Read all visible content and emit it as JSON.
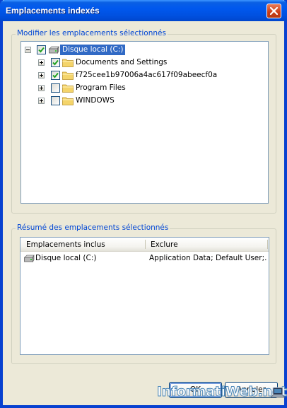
{
  "window": {
    "title": "Emplacements indexés"
  },
  "modify_group": {
    "legend": "Modifier les emplacements sélectionnés",
    "tree": [
      {
        "label": "Disque local (C:)",
        "level": 0,
        "expanded": true,
        "checked": true,
        "icon": "drive-icon",
        "selected": true
      },
      {
        "label": "Documents and Settings",
        "level": 1,
        "expanded": false,
        "checked": true,
        "icon": "folder-icon",
        "selected": false
      },
      {
        "label": "f725cee1b97006a4ac617f09abeecf0a",
        "level": 1,
        "expanded": false,
        "checked": true,
        "icon": "folder-icon",
        "selected": false
      },
      {
        "label": "Program Files",
        "level": 1,
        "expanded": false,
        "checked": false,
        "icon": "folder-icon",
        "selected": false
      },
      {
        "label": "WINDOWS",
        "level": 1,
        "expanded": false,
        "checked": false,
        "icon": "folder-icon",
        "selected": false
      }
    ]
  },
  "summary_group": {
    "legend": "Résumé des emplacements sélectionnés",
    "columns": [
      "Emplacements inclus",
      "Exclure"
    ],
    "rows": [
      {
        "included": "Disque local (C:)",
        "exclude": "Application Data; Default User;...",
        "icon": "drive-icon"
      }
    ]
  },
  "buttons": {
    "ok": "OK",
    "cancel": "Annuler"
  },
  "watermark": "InformatiWeb.net",
  "colors": {
    "title_bar": "#0054e3",
    "legend_text": "#0046d5",
    "selection": "#316ac5",
    "check": "#21a121",
    "folder": "#f4d46a"
  }
}
